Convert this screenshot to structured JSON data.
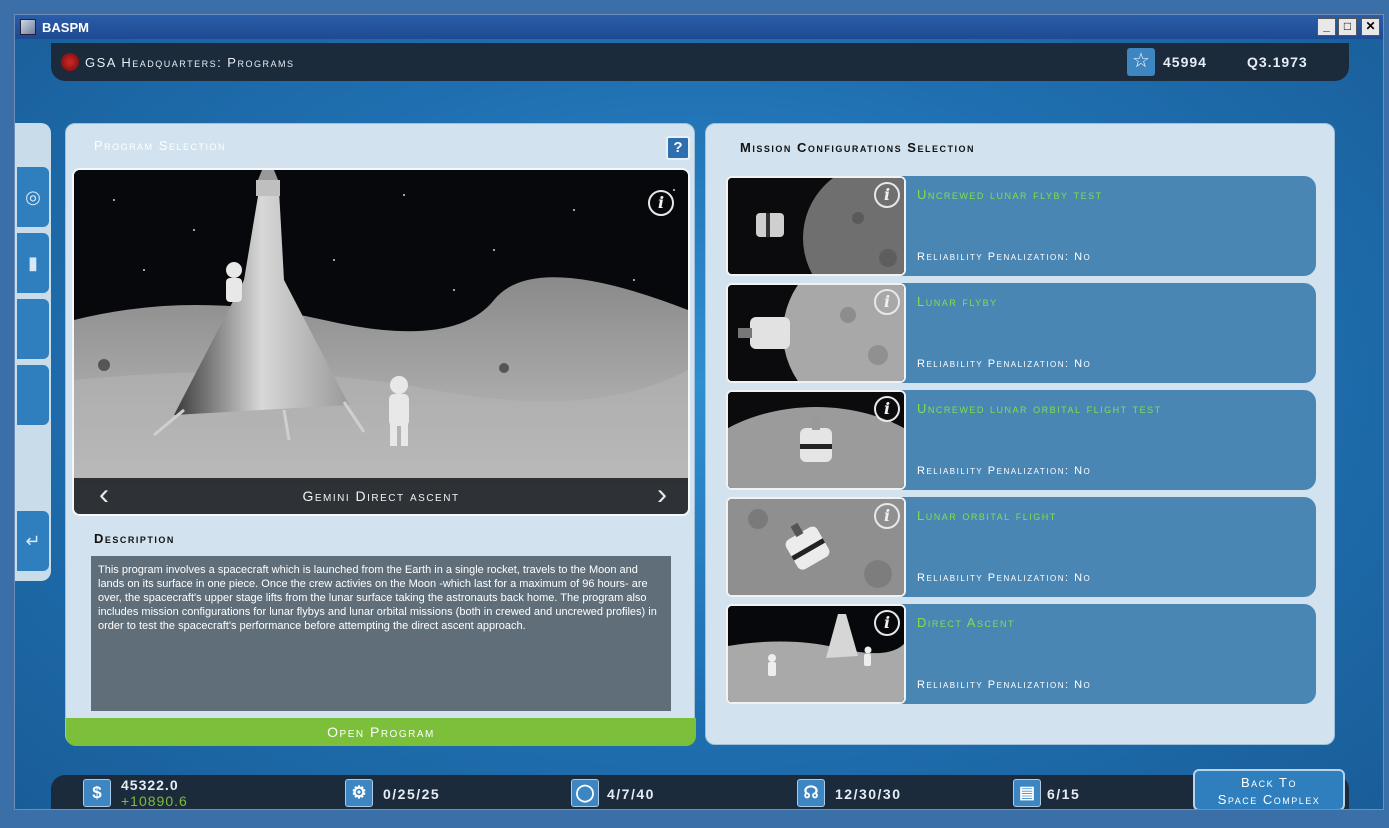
{
  "window": {
    "title": "BASPM",
    "minimize": "_",
    "maximize": "□",
    "close": "✕"
  },
  "header": {
    "title": "GSA Headquarters:  Programs",
    "points": "45994",
    "date": "Q3.1973",
    "icons": [
      "gsa-logo-icon",
      "star-icon"
    ]
  },
  "sidebar": {
    "icons": [
      "navigation-icon",
      "building-icon",
      "blank",
      "blank",
      "return-icon"
    ]
  },
  "program": {
    "panel_title": "Program Selection",
    "help_label": "?",
    "info_label": "i",
    "name": "Gemini Direct ascent",
    "prev_arrow": "‹",
    "next_arrow": "›",
    "description_title": "Description",
    "description": "This program involves a spacecraft which is launched from the Earth in a single rocket, travels to the Moon and lands on its surface in one piece. Once the crew activies on the Moon -which last for a maximum of 96 hours- are over, the spacecraft's upper stage lifts from the lunar surface taking the astronauts back home. The program also includes mission configurations for lunar flybys and lunar orbital missions (both in crewed and uncrewed profiles) in order to test the spacecraft's performance before attempting the direct ascent approach.",
    "open_button": "Open Program"
  },
  "missions": {
    "panel_title": "Mission Configurations Selection",
    "info_label": "i",
    "items": [
      {
        "name": "Uncrewed lunar flyby test",
        "reliability": "Reliability Penalization: No"
      },
      {
        "name": "Lunar flyby",
        "reliability": "Reliability Penalization: No"
      },
      {
        "name": "Uncrewed lunar orbital flight test",
        "reliability": "Reliability Penalization: No"
      },
      {
        "name": "Lunar orbital flight",
        "reliability": "Reliability Penalization: No"
      },
      {
        "name": "Direct Ascent",
        "reliability": "Reliability Penalization: No"
      }
    ]
  },
  "status_bar": {
    "funds": "45322.0",
    "income": "+10890.6",
    "facilities": "0/25/25",
    "capsules": "4/7/40",
    "astronauts": "12/30/30",
    "programs": "6/15",
    "icons": {
      "funds": "$",
      "facilities": "⚙",
      "capsules": "◯",
      "astronauts": "☊",
      "programs": "▤"
    }
  },
  "back_button": {
    "line1": "Back To",
    "line2": "Space Complex"
  },
  "colors": {
    "accent_green": "#7bbf3a",
    "mission_green": "#7fe04a",
    "panel_bg": "#d2e3ef",
    "header_bg": "#1c2b3c"
  }
}
